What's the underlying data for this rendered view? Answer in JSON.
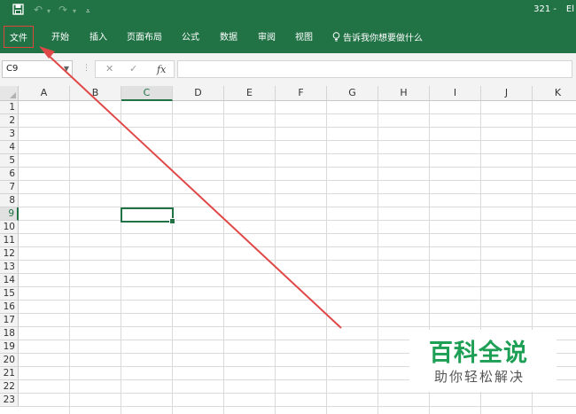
{
  "colors": {
    "ribbon": "#217346",
    "accent": "#217346",
    "arrow": "#e04848",
    "watermark": "#1d9f55"
  },
  "quick_access": {
    "icons": [
      "save-icon",
      "undo-icon",
      "dropdown-icon",
      "redo-icon",
      "dropdown-icon",
      "customize-qat-icon"
    ]
  },
  "title": {
    "text": "321 -",
    "extra": "El"
  },
  "tabs": [
    {
      "label": "文件"
    },
    {
      "label": "开始"
    },
    {
      "label": "插入"
    },
    {
      "label": "页面布局"
    },
    {
      "label": "公式"
    },
    {
      "label": "数据"
    },
    {
      "label": "审阅"
    },
    {
      "label": "视图"
    }
  ],
  "tell_me": {
    "icon": "lightbulb-icon",
    "label": "告诉我你想要做什么"
  },
  "formula_bar": {
    "name_box": "C9",
    "cancel": "✕",
    "enter": "✓",
    "fx": "fx",
    "value": ""
  },
  "columns": [
    "A",
    "B",
    "C",
    "D",
    "E",
    "F",
    "G",
    "H",
    "I",
    "J",
    "K"
  ],
  "rows": [
    "1",
    "2",
    "3",
    "4",
    "5",
    "6",
    "7",
    "8",
    "9",
    "10",
    "11",
    "12",
    "13",
    "14",
    "15",
    "16",
    "17",
    "18",
    "19",
    "20",
    "21",
    "22",
    "23"
  ],
  "selection": {
    "column": "C",
    "row": "9"
  },
  "watermark": {
    "title": "百科全说",
    "subtitle": "助你轻松解决"
  }
}
